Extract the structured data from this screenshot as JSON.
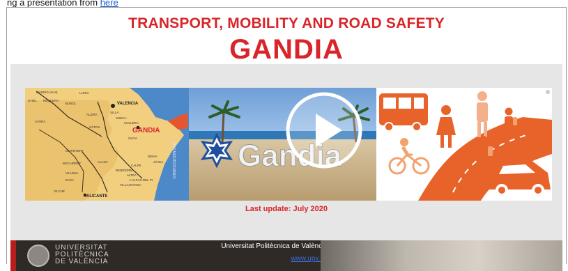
{
  "intro": {
    "text": "ng a presentation from ",
    "link": "here"
  },
  "header": {
    "title": "TRANSPORT, MOBILITY AND ROAD SAFETY",
    "subtitle": "GANDIA"
  },
  "banner": {
    "map": {
      "labels": {
        "madrid": "MADRID (N-III)",
        "lliria": "LLIRIA",
        "valencia": "VALENCIA",
        "utiel": "UTIEL",
        "requena": "REQUENA",
        "buñol": "BUÑOL",
        "silla": "SILLA",
        "alzira": "ALZIRA",
        "sueca": "SUECA",
        "cullera": "CULLERA",
        "ayora": "AYORA",
        "xativa": "XÀTIVA",
        "gandia": "GANDIA",
        "oliva": "OLIVA",
        "denia": "DENIA",
        "javea": "JÁVEA",
        "ontinyent": "ONTINYENT",
        "alcoy": "ALCOY",
        "benidorm": "BENIDORM",
        "calpe": "CALPE",
        "altea": "ALTEA",
        "alfas": "L'ALFÀS DEL PI",
        "bocairent": "BOCAIRENT",
        "villena": "VILLENA",
        "elda": "ELDA",
        "villajoyosa": "VILLAJOYOSA",
        "elche": "ELCHE",
        "alicante": "ALICANTE",
        "sea": "MAR MEDITERRÁNEO"
      }
    },
    "beach": {
      "sign": "Gandia"
    }
  },
  "last_update": "Last update: July 2020",
  "footer": {
    "logo_lines": [
      "UNIVERSITAT",
      "POLITÈCNICA",
      "DE VALÈNCIA"
    ],
    "university_name": "Universitat Politècnica de València",
    "url": "www.upv.es"
  },
  "colors": {
    "title_red": "#d9252a",
    "panel_gray": "#e6e6e6",
    "mobility_orange": "#e8632a",
    "map_yellow": "#f1cf7e",
    "sea_blue": "#4d88c8"
  }
}
